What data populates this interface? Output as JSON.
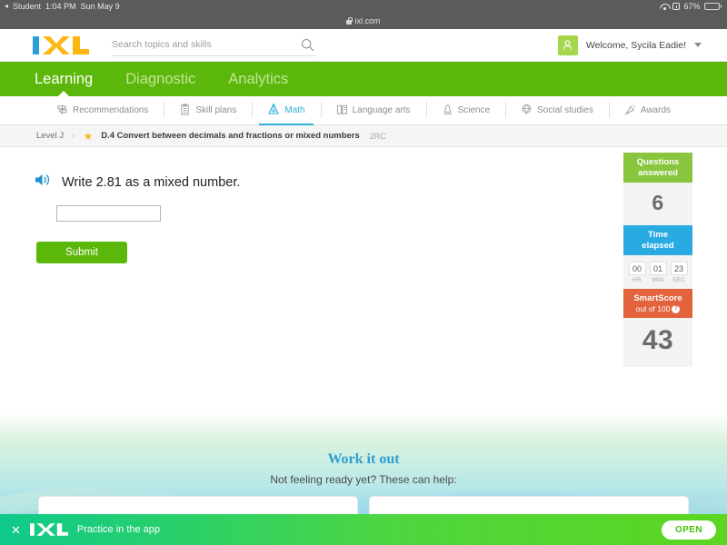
{
  "status_bar": {
    "back_label": "Student",
    "back_icon": "triangle-left-icon",
    "time": "1:04 PM",
    "date": "Sun May 9",
    "wifi_icon": "wifi-icon",
    "alarm_icon": "alarm-icon",
    "battery_percent": "67%",
    "battery_icon": "battery-icon"
  },
  "browser": {
    "lock_icon": "lock-icon",
    "url": "ixl.com"
  },
  "header": {
    "logo": "ixl-logo",
    "search": {
      "placeholder": "Search topics and skills",
      "value": "",
      "icon": "search-icon"
    },
    "account": {
      "avatar_icon": "user-avatar-icon",
      "label": "Welcome, Sycila Eadie!",
      "caret_icon": "chevron-down-icon"
    }
  },
  "main_nav": {
    "items": [
      {
        "label": "Learning",
        "active": true
      },
      {
        "label": "Diagnostic",
        "active": false
      },
      {
        "label": "Analytics",
        "active": false
      }
    ]
  },
  "subject_nav": {
    "items": [
      {
        "label": "Recommendations",
        "icon": "signpost-icon",
        "active": false
      },
      {
        "label": "Skill plans",
        "icon": "clipboard-icon",
        "active": false
      },
      {
        "label": "Math",
        "icon": "compass-icon",
        "active": true
      },
      {
        "label": "Language arts",
        "icon": "book-icon",
        "active": false
      },
      {
        "label": "Science",
        "icon": "microscope-icon",
        "active": false
      },
      {
        "label": "Social studies",
        "icon": "globe-icon",
        "active": false
      },
      {
        "label": "Awards",
        "icon": "confetti-icon",
        "active": false
      }
    ]
  },
  "breadcrumb": {
    "level": "Level J",
    "separator": "›",
    "star_icon": "star-icon",
    "skill_title": "D.4 Convert between decimals and fractions or mixed numbers",
    "skill_code": "2RC"
  },
  "question": {
    "speaker_icon": "speaker-icon",
    "text": "Write 2.81 as a mixed number.",
    "answer_value": "",
    "answer_placeholder": "",
    "submit_label": "Submit"
  },
  "score_panel": {
    "questions": {
      "title_line1": "Questions",
      "title_line2": "answered",
      "value": "6",
      "color": "#8ac53e"
    },
    "time": {
      "title_line1": "Time",
      "title_line2": "elapsed",
      "color": "#29abe2",
      "units": [
        {
          "value": "00",
          "label": "HR"
        },
        {
          "value": "01",
          "label": "MIN"
        },
        {
          "value": "23",
          "label": "SEC"
        }
      ]
    },
    "smartscore": {
      "title": "SmartScore",
      "subtitle": "out of 100",
      "help_icon": "question-mark-icon",
      "help_label": "?",
      "value": "43",
      "color": "#e2633c"
    }
  },
  "work_it_out": {
    "title": "Work it out",
    "subtitle": "Not feeling ready yet? These can help:",
    "cards": [
      {
        "text": ""
      },
      {
        "text": ""
      }
    ]
  },
  "app_banner": {
    "close_icon": "close-icon",
    "close_label": "✕",
    "logo": "ixl-logo-white",
    "text": "Practice in the app",
    "open_label": "OPEN"
  }
}
